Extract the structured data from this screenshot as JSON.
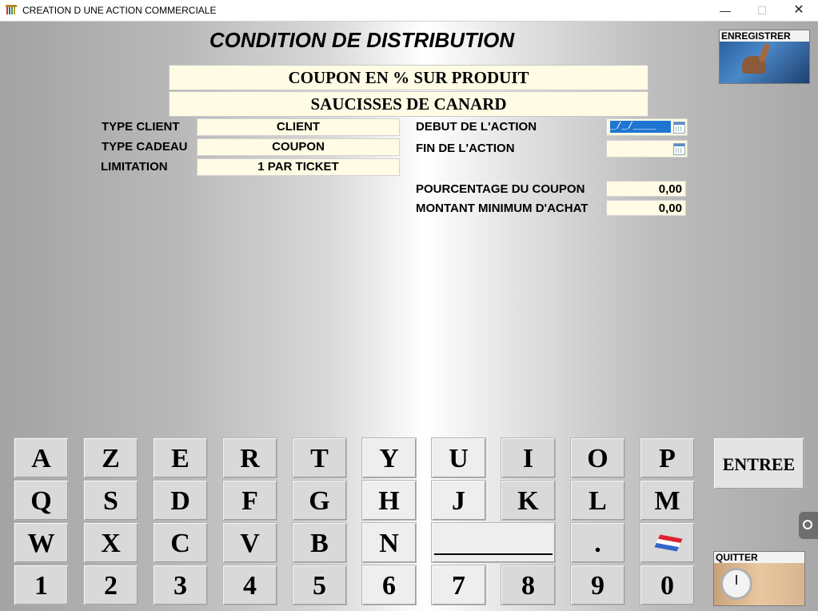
{
  "window": {
    "title": "CREATION D UNE ACTION COMMERCIALE",
    "minimize": "—",
    "maximize": "☐",
    "close": "✕"
  },
  "heading": "CONDITION DE DISTRIBUTION",
  "banners": {
    "type": "COUPON EN % SUR PRODUIT",
    "product": "SAUCISSES DE CANARD"
  },
  "left_fields": [
    {
      "label": "TYPE CLIENT",
      "value": "CLIENT"
    },
    {
      "label": "TYPE CADEAU",
      "value": "COUPON"
    },
    {
      "label": "LIMITATION",
      "value": "1 PAR TICKET"
    }
  ],
  "right_fields": {
    "start_label": "DEBUT DE L'ACTION",
    "start_value": "_/_/____",
    "end_label": "FIN DE L'ACTION",
    "end_value": "",
    "percent_label": "POURCENTAGE DU COUPON",
    "percent_value": "0,00",
    "min_label": "MONTANT MINIMUM D'ACHAT",
    "min_value": "0,00"
  },
  "actions": {
    "save_label": "ENREGISTRER",
    "quit_label": "QUITTER",
    "enter_label": "ENTREE"
  },
  "keyboard": {
    "row1": [
      "A",
      "Z",
      "E",
      "R",
      "T",
      "Y",
      "U",
      "I",
      "O",
      "P"
    ],
    "row2": [
      "Q",
      "S",
      "D",
      "F",
      "G",
      "H",
      "J",
      "K",
      "L",
      "M"
    ],
    "row3": [
      "W",
      "X",
      "C",
      "V",
      "B",
      "N",
      "."
    ],
    "row4": [
      "1",
      "2",
      "3",
      "4",
      "5",
      "6",
      "7",
      "8",
      "9",
      "0"
    ]
  }
}
